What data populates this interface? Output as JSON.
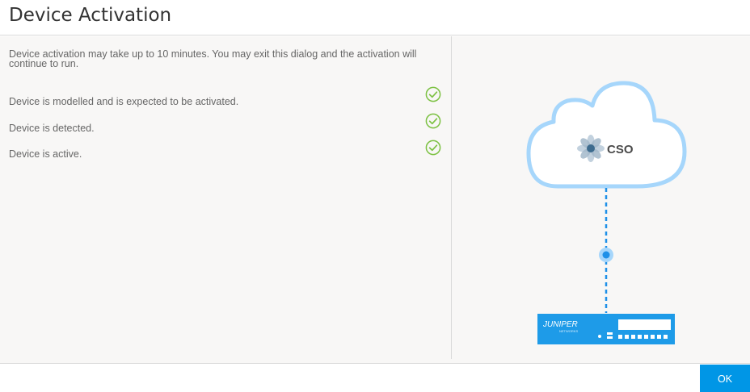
{
  "dialog": {
    "title": "Device Activation",
    "intro": "Device activation may take up to 10 minutes. You may exit this dialog and the activation will continue to run.",
    "steps": [
      {
        "label": "Device is modelled and is expected to be activated.",
        "status": "complete"
      },
      {
        "label": "Device is detected.",
        "status": "complete"
      },
      {
        "label": "Device is active.",
        "status": "complete"
      }
    ],
    "illustration": {
      "cloud_label": "CSO",
      "device_brand": "JUNIPER",
      "device_brand_sub": "NETWORKS"
    },
    "ok_label": "OK"
  },
  "colors": {
    "accent": "#0096e6",
    "check": "#7cc142",
    "cloud_stroke": "#a6d6fb",
    "connector": "#1e90e8",
    "device": "#1e9be8"
  }
}
